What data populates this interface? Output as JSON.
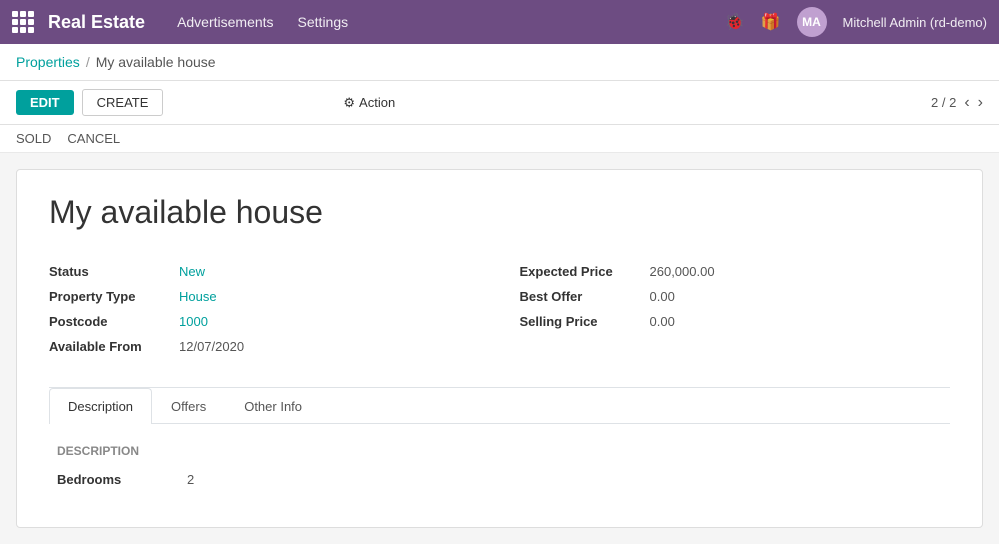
{
  "app": {
    "brand": "Real Estate",
    "nav_links": [
      "Advertisements",
      "Settings"
    ],
    "user": "Mitchell Admin (rd-demo)",
    "icons": {
      "grid": "grid-icon",
      "bug": "🐞",
      "gift": "🎁"
    }
  },
  "breadcrumb": {
    "parent": "Properties",
    "current": "My available house"
  },
  "toolbar": {
    "edit_label": "EDIT",
    "create_label": "CREATE",
    "action_label": "Action",
    "page_current": "2",
    "page_total": "2"
  },
  "status_buttons": {
    "sold": "SOLD",
    "cancel": "CANCEL"
  },
  "record": {
    "title": "My available house",
    "fields_left": [
      {
        "label": "Status",
        "value": "New",
        "plain": false
      },
      {
        "label": "Property Type",
        "value": "House",
        "plain": false
      },
      {
        "label": "Postcode",
        "value": "1000",
        "plain": false
      },
      {
        "label": "Available From",
        "value": "12/07/2020",
        "plain": true
      }
    ],
    "fields_right": [
      {
        "label": "Expected Price",
        "value": "260,000.00",
        "plain": true
      },
      {
        "label": "Best Offer",
        "value": "0.00",
        "plain": true
      },
      {
        "label": "Selling Price",
        "value": "0.00",
        "plain": true
      }
    ]
  },
  "tabs": [
    {
      "id": "description",
      "label": "Description",
      "active": true
    },
    {
      "id": "offers",
      "label": "Offers",
      "active": false
    },
    {
      "id": "other-info",
      "label": "Other Info",
      "active": false
    }
  ],
  "tab_content": {
    "description": {
      "section_label": "Description",
      "fields": [
        {
          "label": "Bedrooms",
          "value": "2"
        }
      ]
    }
  }
}
